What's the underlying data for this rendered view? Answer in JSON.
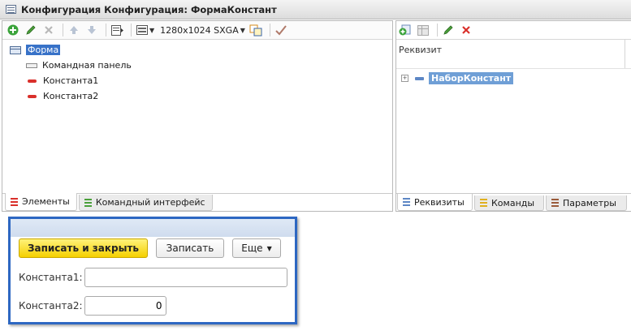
{
  "window": {
    "title": "Конфигурация Конфигурация: ФормаКонстант"
  },
  "toolbar": {
    "resolution": "1280x1024 SXGA"
  },
  "elements_tree": [
    {
      "label": "Форма",
      "icon": "form-icon"
    },
    {
      "label": "Командная панель",
      "icon": "command-panel-icon"
    },
    {
      "label": "Константа1",
      "icon": "field-icon"
    },
    {
      "label": "Константа2",
      "icon": "field-icon"
    }
  ],
  "left_tabs": [
    {
      "label": "Элементы",
      "color": "#d9302b"
    },
    {
      "label": "Командный интерфейс",
      "color": "#4aa03a"
    }
  ],
  "right_pane": {
    "column_header": "Реквизит",
    "tree_item": "НаборКонстант"
  },
  "right_tabs": [
    {
      "label": "Реквизиты",
      "color": "#5d87c5"
    },
    {
      "label": "Команды",
      "color": "#e0b020"
    },
    {
      "label": "Параметры",
      "color": "#9a5a3a"
    }
  ],
  "preview": {
    "save_close": "Записать и закрыть",
    "save": "Записать",
    "more": "Еще",
    "fields": [
      {
        "label": "Константа1:",
        "value": ""
      },
      {
        "label": "Константа2:",
        "value": "0"
      }
    ]
  }
}
